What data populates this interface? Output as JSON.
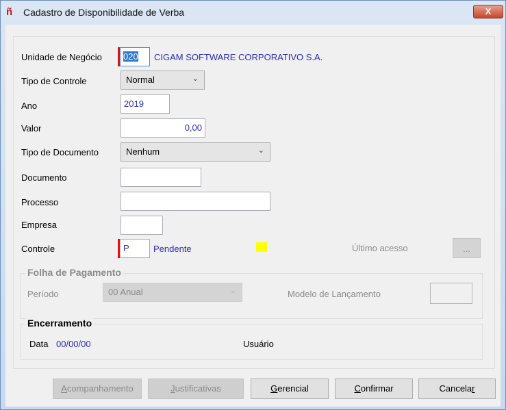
{
  "window": {
    "title": "Cadastro de Disponibilidade de Verba",
    "close_label": "X"
  },
  "form": {
    "unidade": {
      "label": "Unidade de Negócio",
      "code": "020",
      "name": "CIGAM SOFTWARE CORPORATIVO S.A."
    },
    "tipo_controle": {
      "label": "Tipo de Controle",
      "value": "Normal"
    },
    "ano": {
      "label": "Ano",
      "value": "2019"
    },
    "valor": {
      "label": "Valor",
      "value": "0,00"
    },
    "tipo_documento": {
      "label": "Tipo de Documento",
      "value": "Nenhum"
    },
    "documento": {
      "label": "Documento",
      "value": ""
    },
    "processo": {
      "label": "Processo",
      "value": ""
    },
    "empresa": {
      "label": "Empresa",
      "value": ""
    },
    "controle": {
      "label": "Controle",
      "code": "P",
      "description": "Pendente",
      "status_color": "#ffff00"
    },
    "ultimo_acesso": {
      "label": "Último acesso",
      "button": "..."
    }
  },
  "folha": {
    "title": "Folha de Pagamento",
    "periodo_label": "Período",
    "periodo_value": "00 Anual",
    "modelo_label": "Modelo de Lançamento",
    "modelo_value": ""
  },
  "encerramento": {
    "title": "Encerramento",
    "data_label": "Data",
    "data_value": "00/00/00",
    "usuario_label": "Usuário"
  },
  "buttons": {
    "acompanhamento": {
      "first": "A",
      "rest": "companhamento"
    },
    "justificativas": {
      "first": "J",
      "rest": "ustificativas"
    },
    "gerencial": {
      "first": "G",
      "rest": "erencial"
    },
    "confirmar": {
      "first": "C",
      "rest": "onfirmar"
    },
    "cancelar": {
      "pre": "Cancela",
      "u": "r"
    }
  }
}
